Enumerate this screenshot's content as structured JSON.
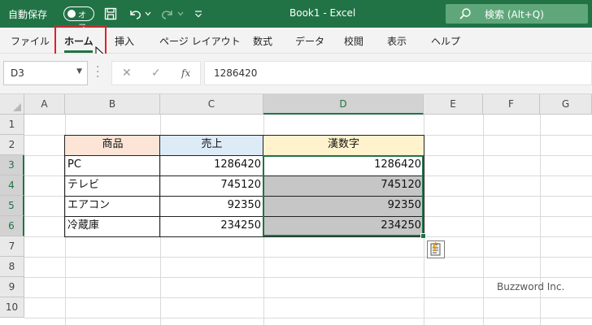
{
  "titlebar": {
    "autosave_label": "自動保存",
    "autosave_state": "オフ",
    "doc_title": "Book1  -  Excel",
    "search_placeholder": "検索 (Alt+Q)",
    "bg_color": "#217346",
    "icons": [
      "save-icon",
      "undo-icon",
      "redo-icon",
      "customize-qat-icon",
      "search-icon"
    ]
  },
  "ribbon": {
    "tabs": [
      {
        "label": "ファイル",
        "active": false
      },
      {
        "label": "ホーム",
        "active": true
      },
      {
        "label": "挿入",
        "active": false
      },
      {
        "label": "ページ レイアウト",
        "active": false
      },
      {
        "label": "数式",
        "active": false
      },
      {
        "label": "データ",
        "active": false
      },
      {
        "label": "校閲",
        "active": false
      },
      {
        "label": "表示",
        "active": false
      },
      {
        "label": "ヘルプ",
        "active": false
      }
    ]
  },
  "formula_bar": {
    "name_box": "D3",
    "fx_label": "fx",
    "value": "1286420"
  },
  "sheet": {
    "columns": [
      "A",
      "B",
      "C",
      "D",
      "E",
      "F",
      "G"
    ],
    "selected_column": "D",
    "rows": [
      "1",
      "2",
      "3",
      "4",
      "5",
      "6",
      "7",
      "8",
      "9",
      "10"
    ],
    "selected_rows": [
      "3",
      "4",
      "5",
      "6"
    ],
    "table": {
      "headers": [
        "商品",
        "売上",
        "漢数字"
      ],
      "header_colors": [
        "#fce4d6",
        "#ddebf7",
        "#fff2cc"
      ],
      "rows": [
        {
          "product": "PC",
          "sales": "1286420",
          "kanji": "1286420"
        },
        {
          "product": "テレビ",
          "sales": "745120",
          "kanji": "745120"
        },
        {
          "product": "エアコン",
          "sales": "92350",
          "kanji": "92350"
        },
        {
          "product": "冷蔵庫",
          "sales": "234250",
          "kanji": "234250"
        }
      ]
    },
    "selected_range": "D3:D6",
    "selection_color": "#c6c6c6",
    "accent_color": "#217346"
  },
  "watermark": "Buzzword Inc."
}
